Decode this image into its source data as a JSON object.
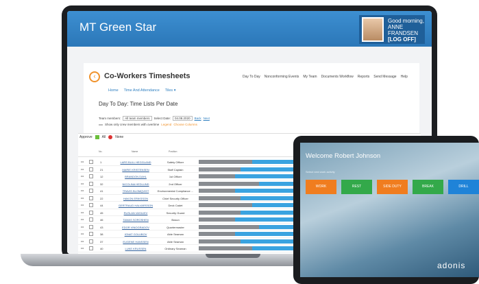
{
  "app": {
    "title": "MT Green Star",
    "greeting": "Good morning, ANNE FRANDSEN",
    "logoff": "[LOG OFF]"
  },
  "page": {
    "title": "Co-Workers Timesheets",
    "topnav": [
      "Day To Day",
      "Nonconforming Events",
      "My Team",
      "Documents Workflow",
      "Reports",
      "Send Message",
      "Help"
    ],
    "breadcrumb": [
      "Home",
      "Time And Attendance",
      "Tiles ▾"
    ],
    "section_title": "Day To Day: Time Lists Per Date",
    "team_label": "Team members:",
    "team_value": "All team members",
    "date_label": "Select Date:",
    "date_value": "04.08.2020",
    "back_label": "Back",
    "next_label": "Next",
    "overtime_label": "Show only crew members with overtime",
    "legend_label": "Legend",
    "columns_label": "Choose Columns"
  },
  "grid": {
    "approve_label": "Approve",
    "all_label": "All",
    "none_label": "None",
    "header_no": "No.",
    "header_name": "Name",
    "header_position": "Position",
    "rows": [
      {
        "no": "1",
        "name": "LARS BULL HEGGLAND",
        "position": "Safety Officer"
      },
      {
        "no": "21",
        "name": "MARIE KRISTENSEN",
        "position": "Staff Captain"
      },
      {
        "no": "12",
        "name": "BRANDON DAHL",
        "position": "1st Officer"
      },
      {
        "no": "32",
        "name": "NICOLINA HEDLUND",
        "position": "2nd Officer"
      },
      {
        "no": "41",
        "name": "TRAVIS BLOMQVIST",
        "position": "Environmental Compliance ..."
      },
      {
        "no": "22",
        "name": "HAKON ERIKSSON",
        "position": "Chief Security Officer"
      },
      {
        "no": "44",
        "name": "GERTRAUD HALVARSSON",
        "position": "Deck Cadet"
      },
      {
        "no": "45",
        "name": "RUSLAN VASILIEV",
        "position": "Security Guard"
      },
      {
        "no": "46",
        "name": "TAMAS SOROSHEN",
        "position": "Bosun"
      },
      {
        "no": "43",
        "name": "EDOR VINOGRADOV",
        "position": "Quartermaster"
      },
      {
        "no": "38",
        "name": "IGNAT GOLUBOV",
        "position": "Able Seaman"
      },
      {
        "no": "37",
        "name": "EUGENE HANSSEN",
        "position": "Able Seaman"
      },
      {
        "no": "40",
        "name": "LUKE KRUSSEN",
        "position": "Ordinary Seaman"
      }
    ]
  },
  "tablet": {
    "welcome": "Welcome Robert Johnson",
    "subtitle": "Select next work activity",
    "buttons": [
      {
        "label": "WORK",
        "color": "#f07d1f"
      },
      {
        "label": "REST",
        "color": "#33a94a"
      },
      {
        "label": "SIDE DUTY",
        "color": "#f07d1f"
      },
      {
        "label": "BREAK",
        "color": "#33a94a"
      },
      {
        "label": "DRILL",
        "color": "#1f83d8"
      }
    ],
    "brand": "adonis"
  }
}
